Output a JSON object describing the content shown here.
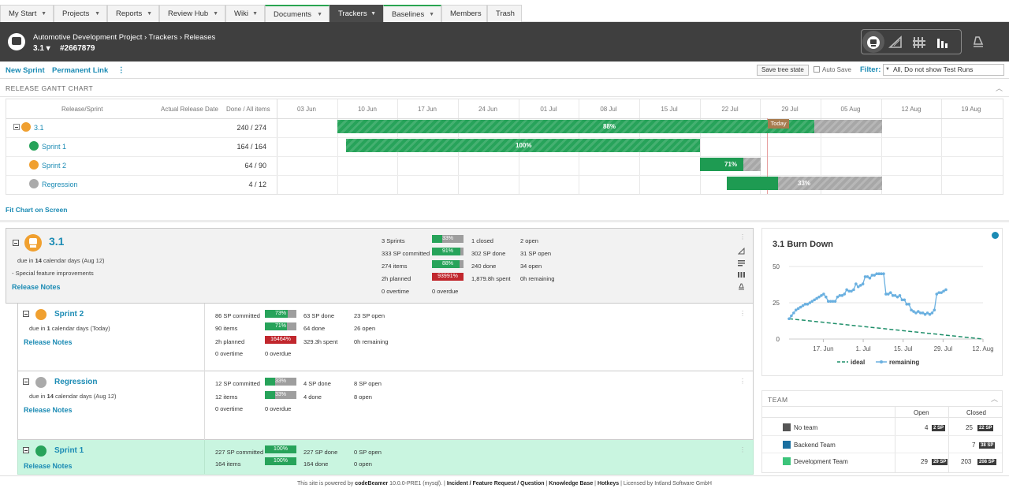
{
  "nav": {
    "tabs": [
      {
        "label": "My Start",
        "dropdown": true
      },
      {
        "label": "Projects",
        "dropdown": true
      },
      {
        "label": "Reports",
        "dropdown": true
      },
      {
        "label": "Review Hub",
        "dropdown": true
      },
      {
        "label": "Wiki",
        "dropdown": true
      },
      {
        "label": "Documents",
        "dropdown": true
      },
      {
        "label": "Trackers",
        "dropdown": true,
        "active": true
      },
      {
        "label": "Baselines",
        "dropdown": true
      },
      {
        "label": "Members",
        "dropdown": false
      },
      {
        "label": "Trash",
        "dropdown": false
      }
    ]
  },
  "header": {
    "breadcrumb": "Automotive Development Project › Trackers › Releases",
    "release": "3.1 ▾",
    "id": "#2667879",
    "tool_icons": [
      "release-icon",
      "planner-icon",
      "cardboard-icon",
      "statistics-icon",
      "traceability-icon"
    ]
  },
  "toolbar": {
    "new_sprint": "New Sprint",
    "permalink": "Permanent Link",
    "more": "⋮",
    "save_tree": "Save tree state",
    "auto_save": "Auto Save",
    "filter_label": "Filter:",
    "filter_value": "All, Do not show Test Runs"
  },
  "gantt": {
    "title": "RELEASE GANTT CHART",
    "col_release": "Release/Sprint",
    "col_actual": "Actual Release Date",
    "col_done": "Done / All items",
    "dates": [
      "03 Jun",
      "10 Jun",
      "17 Jun",
      "24 Jun",
      "01 Jul",
      "08 Jul",
      "15 Jul",
      "22 Jul",
      "29 Jul",
      "05 Aug",
      "12 Aug",
      "19 Aug"
    ],
    "today_label": "Today",
    "rows": [
      {
        "name": "3.1",
        "done": "240 / 274",
        "pct": "88%",
        "color": "#f0a030"
      },
      {
        "name": "Sprint 1",
        "done": "164 / 164",
        "pct": "100%",
        "color": "#27a35a"
      },
      {
        "name": "Sprint 2",
        "done": "64 / 90",
        "pct": "71%",
        "color": "#f0a030"
      },
      {
        "name": "Regression",
        "done": "4 / 12",
        "pct": "33%",
        "color": "#999999"
      }
    ],
    "fit_chart": "Fit Chart on Screen"
  },
  "release": {
    "name": "3.1",
    "due_prefix": "due in",
    "due_days": "14",
    "due_suffix": "calendar days (Aug 12)",
    "desc": "- Special feature improvements",
    "notes": "Release Notes",
    "stats": {
      "sprints": "3 Sprints",
      "sprints_pct": "33%",
      "closed": "1 closed",
      "open": "2 open",
      "committed": "333 SP committed",
      "committed_pct": "91%",
      "done_sp": "302 SP done",
      "open_sp": "31 SP open",
      "items": "274 items",
      "items_pct": "88%",
      "done_items": "240 done",
      "open_items": "34 open",
      "planned": "2h planned",
      "planned_pct": "93991%",
      "spent": "1,879.8h spent",
      "remaining": "0h remaining",
      "overtime": "0 overtime",
      "overdue": "0 overdue"
    },
    "pct_values": {
      "sprints": 33,
      "committed": 91,
      "items": 88
    }
  },
  "sprints": [
    {
      "name": "Sprint 2",
      "due_days": "1",
      "due_suffix": "calendar days (Today)",
      "notes": "Release Notes",
      "committed": "86 SP committed",
      "committed_pct": "73%",
      "committed_val": 73,
      "done": "63 SP done",
      "open": "23 SP open",
      "items": "90 items",
      "items_pct": "71%",
      "items_val": 71,
      "done_items": "64 done",
      "open_items": "26 open",
      "planned": "2h planned",
      "planned_pct": "16464%",
      "spent": "329.3h spent",
      "remaining": "0h remaining",
      "overtime": "0 overtime",
      "overdue": "0 overdue"
    },
    {
      "name": "Regression",
      "due_days": "14",
      "due_suffix": "calendar days (Aug 12)",
      "notes": "Release Notes",
      "committed": "12 SP committed",
      "committed_pct": "33%",
      "committed_val": 33,
      "done": "4 SP done",
      "open": "8 SP open",
      "items": "12 items",
      "items_pct": "33%",
      "items_val": 33,
      "done_items": "4 done",
      "open_items": "8 open",
      "overtime": "0 overtime",
      "overdue": "0 overdue"
    },
    {
      "name": "Sprint 1",
      "notes": "Release Notes",
      "committed": "227 SP committed",
      "committed_pct": "100%",
      "committed_val": 100,
      "done": "227 SP done",
      "open": "0 SP open",
      "items": "164 items",
      "items_pct": "100%",
      "items_val": 100,
      "done_items": "164 done",
      "open_items": "0 open"
    }
  ],
  "burndown": {
    "title": "3.1 Burn Down",
    "y_ticks": [
      "50",
      "25",
      "0"
    ],
    "x_ticks": [
      "17. Jun",
      "1. Jul",
      "15. Jul",
      "29. Jul",
      "12. Aug"
    ],
    "legend_ideal": "ideal",
    "legend_remaining": "remaining",
    "colors": {
      "ideal": "#1f8f6a",
      "remaining": "#6ab0e0"
    }
  },
  "chart_data": {
    "type": "line",
    "title": "3.1 Burn Down",
    "x": [
      "06-05",
      "06-06",
      "06-07",
      "06-08",
      "06-09",
      "06-10",
      "06-11",
      "06-12",
      "06-13",
      "06-14",
      "06-15",
      "06-16",
      "06-17",
      "06-18",
      "06-19",
      "06-20",
      "06-21",
      "06-22",
      "06-23",
      "06-24",
      "06-25",
      "06-26",
      "06-27",
      "06-28",
      "06-29",
      "06-30",
      "07-01",
      "07-02",
      "07-03",
      "07-04",
      "07-05",
      "07-06",
      "07-07",
      "07-08",
      "07-09",
      "07-10",
      "07-11",
      "07-12",
      "07-13",
      "07-14",
      "07-15",
      "07-16",
      "07-17",
      "07-18",
      "07-19",
      "07-20",
      "07-21",
      "07-22",
      "07-23",
      "07-24",
      "07-25",
      "07-26",
      "07-27",
      "07-28",
      "07-29",
      "07-30",
      "07-31",
      "08-01"
    ],
    "series": [
      {
        "name": "remaining",
        "values": [
          14,
          16,
          18,
          20,
          21,
          22,
          23,
          24,
          24,
          25,
          26,
          27,
          28,
          29,
          30,
          31,
          29,
          26,
          26,
          26,
          26,
          29,
          30,
          30,
          31,
          34,
          33,
          33,
          34,
          38,
          36,
          37,
          38,
          43,
          43,
          42,
          44,
          44,
          45,
          45,
          45,
          45,
          31,
          31,
          32,
          30,
          30,
          29,
          30,
          27,
          27,
          24,
          24,
          20,
          19,
          18,
          19,
          18,
          18,
          17,
          18,
          17,
          18,
          20,
          31,
          32,
          32,
          33,
          34
        ]
      },
      {
        "name": "ideal",
        "x": [
          "06-05",
          "08-12"
        ],
        "values": [
          14,
          0
        ]
      }
    ],
    "ylim": [
      0,
      50
    ],
    "xlim": [
      "06-05",
      "08-12"
    ],
    "legend_position": "bottom",
    "grid": true
  },
  "team": {
    "title": "TEAM",
    "col_open": "Open",
    "col_closed": "Closed",
    "rows": [
      {
        "name": "No team",
        "open": "4",
        "open_sp": "2 SP",
        "closed": "25",
        "closed_sp": "22 SP",
        "color": "#555555"
      },
      {
        "name": "Backend Team",
        "open": "",
        "open_sp": "",
        "closed": "7",
        "closed_sp": "38 SP",
        "color": "#1a6fa0"
      },
      {
        "name": "Development Team",
        "open": "29",
        "open_sp": "29 SP",
        "closed": "203",
        "closed_sp": "208 SP",
        "color": "#3cc47a"
      }
    ]
  },
  "footer": {
    "powered": "This site is powered by",
    "product": "codeBeamer",
    "version": "10.0.0-PRE1 (mysql).",
    "links": "Incident / Feature Request / Question",
    "kb": "Knowledge Base",
    "hotkeys": "Hotkeys",
    "license": "Licensed by Intland Software GmbH"
  }
}
